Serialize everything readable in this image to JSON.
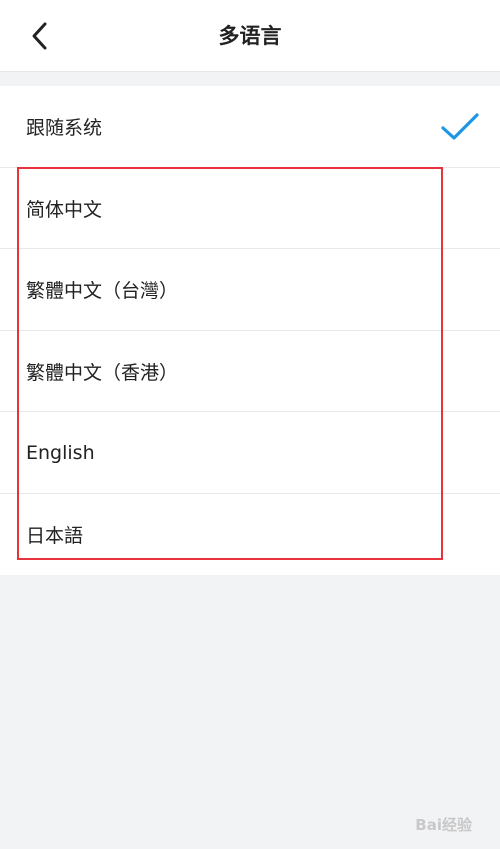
{
  "header": {
    "title": "多语言",
    "back_icon": "chevron-left-icon"
  },
  "languages": {
    "items": [
      {
        "label": "跟随系统",
        "selected": true
      },
      {
        "label": "简体中文",
        "selected": false
      },
      {
        "label": "繁體中文（台灣）",
        "selected": false
      },
      {
        "label": "繁體中文（香港）",
        "selected": false
      },
      {
        "label": "English",
        "selected": false
      },
      {
        "label": "日本語",
        "selected": false
      }
    ]
  },
  "colors": {
    "check": "#1e96e6",
    "highlight_border": "#e8323c",
    "background": "#f2f3f5"
  }
}
